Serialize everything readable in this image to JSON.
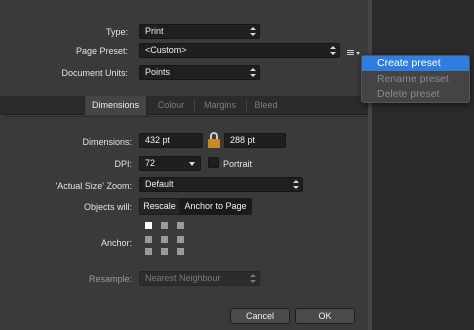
{
  "document": {
    "type_label": "Type:",
    "type_value": "Print",
    "preset_label": "Page Preset:",
    "preset_value": "<Custom>",
    "units_label": "Document Units:",
    "units_value": "Points"
  },
  "tabs": [
    {
      "label": "Dimensions",
      "active": true
    },
    {
      "label": "Colour",
      "active": false
    },
    {
      "label": "Margins",
      "active": false
    },
    {
      "label": "Bleed",
      "active": false
    }
  ],
  "dimensions": {
    "label": "Dimensions:",
    "width": "432 pt",
    "height": "288 pt",
    "dpi_label": "DPI:",
    "dpi_value": "72",
    "portrait_label": "Portrait",
    "zoom_label": "'Actual Size' Zoom:",
    "zoom_value": "Default",
    "objects_label": "Objects will:",
    "objects_options": [
      "Rescale",
      "Anchor to Page"
    ],
    "objects_selected": "Anchor to Page",
    "anchor_label": "Anchor:",
    "resample_label": "Resample:",
    "resample_value": "Nearest Neighbour"
  },
  "preset_menu": {
    "items": [
      {
        "label": "Create preset",
        "enabled": true,
        "highlighted": true
      },
      {
        "label": "Rename preset",
        "enabled": false,
        "highlighted": false
      },
      {
        "label": "Delete preset",
        "enabled": false,
        "highlighted": false
      }
    ]
  },
  "footer": {
    "cancel_label": "Cancel",
    "ok_label": "OK"
  },
  "colors": {
    "accent": "#2f7de1",
    "lock": "#c9872a"
  },
  "icons": {
    "preset_menu": "list-menu-icon",
    "link": "lock-icon"
  }
}
